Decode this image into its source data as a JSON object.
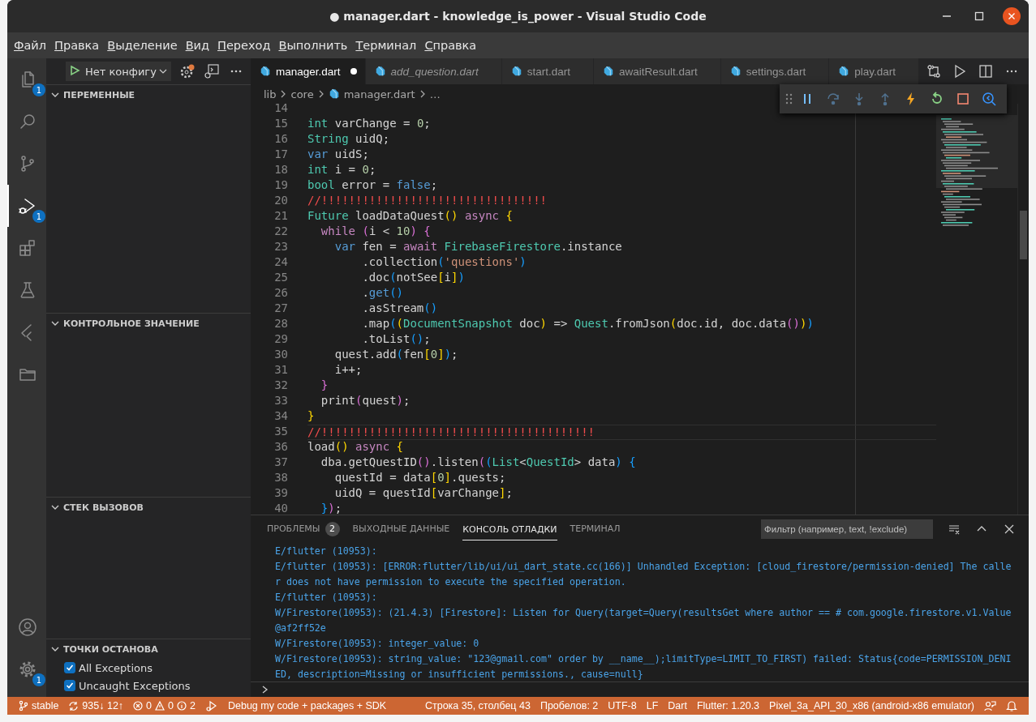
{
  "window": {
    "title": "● manager.dart - knowledge_is_power - Visual Studio Code"
  },
  "menu": [
    "Файл",
    "Правка",
    "Выделение",
    "Вид",
    "Переход",
    "Выполнить",
    "Терминал",
    "Справка"
  ],
  "activity_bar": {
    "items": [
      {
        "kind": "files",
        "selected": false,
        "badge": "1"
      },
      {
        "kind": "search",
        "selected": false
      },
      {
        "kind": "source",
        "selected": false
      },
      {
        "kind": "debug",
        "selected": true,
        "badge": "1"
      },
      {
        "kind": "extensions",
        "selected": false
      },
      {
        "kind": "flask",
        "selected": false
      },
      {
        "kind": "chevrons",
        "selected": false
      },
      {
        "kind": "folder",
        "selected": false
      }
    ],
    "bottom": [
      {
        "kind": "account",
        "selected": false
      },
      {
        "kind": "gear",
        "selected": false,
        "badge": "1"
      }
    ]
  },
  "sidebar": {
    "run_config": "Нет конфигу",
    "sections": [
      {
        "title": "ПЕРЕМЕННЫЕ",
        "expanded": true
      },
      {
        "title": "КОНТРОЛЬНОЕ ЗНАЧЕНИЕ",
        "expanded": true
      },
      {
        "title": "СТЕК ВЫЗОВОВ",
        "expanded": true
      },
      {
        "title": "ТОЧКИ ОСТАНОВА",
        "expanded": true
      }
    ],
    "breakpoints": [
      {
        "label": "All Exceptions",
        "checked": true
      },
      {
        "label": "Uncaught Exceptions",
        "checked": true
      }
    ]
  },
  "tabs": [
    {
      "label": "manager.dart",
      "selected": true,
      "preview": false,
      "modified": true
    },
    {
      "label": "add_question.dart",
      "selected": false,
      "preview": true,
      "modified": false
    },
    {
      "label": "start.dart",
      "selected": false,
      "preview": false,
      "modified": false
    },
    {
      "label": "awaitResult.dart",
      "selected": false,
      "preview": false,
      "modified": false
    },
    {
      "label": "settings.dart",
      "selected": false,
      "preview": false,
      "modified": false
    },
    {
      "label": "play.dart",
      "selected": false,
      "preview": false,
      "modified": false
    }
  ],
  "breadcrumbs": [
    "lib",
    "core",
    "manager.dart",
    "…"
  ],
  "debug_toolbar": [
    {
      "kind": "pause",
      "disabled": false
    },
    {
      "kind": "step-over",
      "disabled": true
    },
    {
      "kind": "step-into",
      "disabled": true
    },
    {
      "kind": "step-out",
      "disabled": true
    },
    {
      "kind": "hot-reload",
      "disabled": false
    },
    {
      "kind": "restart",
      "disabled": false
    },
    {
      "kind": "stop",
      "disabled": false
    },
    {
      "kind": "inspect",
      "disabled": false
    }
  ],
  "code": [
    {
      "number": "14",
      "current": false
    },
    {
      "number": "15",
      "current": false,
      "tokens": [
        {
          "text": "int",
          "kind": "type"
        },
        {
          "text": " varChange = ",
          "kind": "plain"
        },
        {
          "text": "0",
          "kind": "num"
        },
        {
          "text": ";",
          "kind": "plain"
        }
      ]
    },
    {
      "number": "16",
      "current": false,
      "tokens": [
        {
          "text": "String",
          "kind": "type"
        },
        {
          "text": " uidQ;",
          "kind": "plain"
        }
      ]
    },
    {
      "number": "17",
      "current": false,
      "tokens": [
        {
          "text": "var",
          "kind": "kw"
        },
        {
          "text": " uidS;",
          "kind": "plain"
        }
      ]
    },
    {
      "number": "18",
      "current": false,
      "tokens": [
        {
          "text": "int",
          "kind": "type"
        },
        {
          "text": " i = ",
          "kind": "plain"
        },
        {
          "text": "0",
          "kind": "num"
        },
        {
          "text": ";",
          "kind": "plain"
        }
      ]
    },
    {
      "number": "19",
      "current": false,
      "tokens": [
        {
          "text": "bool",
          "kind": "type"
        },
        {
          "text": " error = ",
          "kind": "plain"
        },
        {
          "text": "false",
          "kind": "kw"
        },
        {
          "text": ";",
          "kind": "plain"
        }
      ]
    },
    {
      "number": "20",
      "current": false,
      "tokens": [
        {
          "text": "//!!!!!!!!!!!!!!!!!!!!!!!!!!!!!!!!!",
          "kind": "comment"
        }
      ]
    },
    {
      "number": "21",
      "current": false,
      "tokens": [
        {
          "text": "Future",
          "kind": "type"
        },
        {
          "text": " loadDataQuest",
          "kind": "plain"
        },
        {
          "text": "()",
          "kind": "b1"
        },
        {
          "text": " async",
          "kind": "ctrl"
        },
        {
          "text": " {",
          "kind": "b1"
        }
      ]
    },
    {
      "number": "22",
      "current": false,
      "tokens": [
        {
          "text": "  while",
          "kind": "ctrl"
        },
        {
          "text": " (",
          "kind": "b2"
        },
        {
          "text": "i < ",
          "kind": "plain"
        },
        {
          "text": "10",
          "kind": "num"
        },
        {
          "text": ")",
          "kind": "b2"
        },
        {
          "text": " {",
          "kind": "b2"
        }
      ]
    },
    {
      "number": "23",
      "current": false,
      "tokens": [
        {
          "text": "    var",
          "kind": "kw"
        },
        {
          "text": " fen = ",
          "kind": "plain"
        },
        {
          "text": "await",
          "kind": "ctrl"
        },
        {
          "text": " FirebaseFirestore",
          "kind": "type"
        },
        {
          "text": ".instance",
          "kind": "plain"
        }
      ]
    },
    {
      "number": "24",
      "current": false,
      "tokens": [
        {
          "text": "        .collection",
          "kind": "plain"
        },
        {
          "text": "(",
          "kind": "b3"
        },
        {
          "text": "'questions'",
          "kind": "str"
        },
        {
          "text": ")",
          "kind": "b3"
        }
      ]
    },
    {
      "number": "25",
      "current": false,
      "tokens": [
        {
          "text": "        .doc",
          "kind": "plain"
        },
        {
          "text": "(",
          "kind": "b3"
        },
        {
          "text": "notSee",
          "kind": "plain"
        },
        {
          "text": "[",
          "kind": "b1"
        },
        {
          "text": "i",
          "kind": "plain"
        },
        {
          "text": "]",
          "kind": "b1"
        },
        {
          "text": ")",
          "kind": "b3"
        }
      ]
    },
    {
      "number": "26",
      "current": false,
      "tokens": [
        {
          "text": "        .",
          "kind": "plain"
        },
        {
          "text": "get",
          "kind": "kw"
        },
        {
          "text": "()",
          "kind": "b3"
        }
      ]
    },
    {
      "number": "27",
      "current": false,
      "tokens": [
        {
          "text": "        .asStream",
          "kind": "plain"
        },
        {
          "text": "()",
          "kind": "b3"
        }
      ]
    },
    {
      "number": "28",
      "current": false,
      "tokens": [
        {
          "text": "        .map",
          "kind": "plain"
        },
        {
          "text": "(",
          "kind": "b3"
        },
        {
          "text": "(",
          "kind": "b1"
        },
        {
          "text": "DocumentSnapshot",
          "kind": "type"
        },
        {
          "text": " doc",
          "kind": "plain"
        },
        {
          "text": ")",
          "kind": "b1"
        },
        {
          "text": " => ",
          "kind": "plain"
        },
        {
          "text": "Quest",
          "kind": "type"
        },
        {
          "text": ".fromJson",
          "kind": "plain"
        },
        {
          "text": "(",
          "kind": "b1"
        },
        {
          "text": "doc.id, doc.data",
          "kind": "plain"
        },
        {
          "text": "()",
          "kind": "b2"
        },
        {
          "text": ")",
          "kind": "b1"
        },
        {
          "text": ")",
          "kind": "b3"
        }
      ]
    },
    {
      "number": "29",
      "current": false,
      "tokens": [
        {
          "text": "        .toList",
          "kind": "plain"
        },
        {
          "text": "()",
          "kind": "b3"
        },
        {
          "text": ";",
          "kind": "plain"
        }
      ]
    },
    {
      "number": "30",
      "current": false,
      "tokens": [
        {
          "text": "    quest.add",
          "kind": "plain"
        },
        {
          "text": "(",
          "kind": "b3"
        },
        {
          "text": "fen",
          "kind": "plain"
        },
        {
          "text": "[",
          "kind": "b1"
        },
        {
          "text": "0",
          "kind": "num"
        },
        {
          "text": "]",
          "kind": "b1"
        },
        {
          "text": ")",
          "kind": "b3"
        },
        {
          "text": ";",
          "kind": "plain"
        }
      ]
    },
    {
      "number": "31",
      "current": false,
      "tokens": [
        {
          "text": "    i++;",
          "kind": "plain"
        }
      ]
    },
    {
      "number": "32",
      "current": false,
      "tokens": [
        {
          "text": "  }",
          "kind": "b2"
        }
      ]
    },
    {
      "number": "33",
      "current": false,
      "tokens": [
        {
          "text": "  print",
          "kind": "plain"
        },
        {
          "text": "(",
          "kind": "b2"
        },
        {
          "text": "quest",
          "kind": "plain"
        },
        {
          "text": ")",
          "kind": "b2"
        },
        {
          "text": ";",
          "kind": "plain"
        }
      ]
    },
    {
      "number": "34",
      "current": false,
      "tokens": [
        {
          "text": "}",
          "kind": "b1"
        }
      ]
    },
    {
      "number": "35",
      "current": true,
      "tokens": [
        {
          "text": "//!!!!!!!!!!!!!!!!!!!!!!!!!!!!!!!!!!!!!!!!",
          "kind": "comment"
        }
      ]
    },
    {
      "number": "36",
      "current": false,
      "tokens": [
        {
          "text": "load",
          "kind": "plain"
        },
        {
          "text": "()",
          "kind": "b1"
        },
        {
          "text": " async",
          "kind": "ctrl"
        },
        {
          "text": " {",
          "kind": "b1"
        }
      ]
    },
    {
      "number": "37",
      "current": false,
      "tokens": [
        {
          "text": "  dba.getQuestID",
          "kind": "plain"
        },
        {
          "text": "()",
          "kind": "b2"
        },
        {
          "text": ".listen",
          "kind": "plain"
        },
        {
          "text": "(",
          "kind": "b2"
        },
        {
          "text": "(",
          "kind": "b3"
        },
        {
          "text": "List",
          "kind": "type"
        },
        {
          "text": "<",
          "kind": "plain"
        },
        {
          "text": "QuestId",
          "kind": "type"
        },
        {
          "text": "> data",
          "kind": "plain"
        },
        {
          "text": ")",
          "kind": "b3"
        },
        {
          "text": " {",
          "kind": "b3"
        }
      ]
    },
    {
      "number": "38",
      "current": false,
      "tokens": [
        {
          "text": "    questId = data",
          "kind": "plain"
        },
        {
          "text": "[",
          "kind": "b1"
        },
        {
          "text": "0",
          "kind": "num"
        },
        {
          "text": "]",
          "kind": "b1"
        },
        {
          "text": ".quests;",
          "kind": "plain"
        }
      ]
    },
    {
      "number": "39",
      "current": false,
      "tokens": [
        {
          "text": "    uidQ = questId",
          "kind": "plain"
        },
        {
          "text": "[",
          "kind": "b1"
        },
        {
          "text": "varChange",
          "kind": "plain"
        },
        {
          "text": "]",
          "kind": "b1"
        },
        {
          "text": ";",
          "kind": "plain"
        }
      ]
    },
    {
      "number": "40",
      "current": false,
      "tokens": [
        {
          "text": "  }",
          "kind": "b3"
        },
        {
          "text": ")",
          "kind": "b2"
        },
        {
          "text": ";",
          "kind": "plain"
        }
      ]
    }
  ],
  "panel": {
    "tabs": [
      {
        "label": "ПРОБЛЕМЫ",
        "selected": false,
        "badge": "2"
      },
      {
        "label": "ВЫХОДНЫЕ ДАННЫЕ",
        "selected": false
      },
      {
        "label": "КОНСОЛЬ ОТЛАДКИ",
        "selected": true
      },
      {
        "label": "ТЕРМИНАЛ",
        "selected": false
      }
    ],
    "filter": {
      "placeholder": "Фильтр (например, text, !exclude)"
    },
    "output": [
      "E/flutter (10953):",
      "E/flutter (10953): [ERROR:flutter/lib/ui/ui_dart_state.cc(166)] Unhandled Exception: [cloud_firestore/permission-denied] The calle",
      "r does not have permission to execute the specified operation.",
      "E/flutter (10953):",
      "W/Firestore(10953): (21.4.3) [Firestore]: Listen for Query(target=Query(resultsGet where author == # com.google.firestore.v1.Value",
      "@af2ff52e",
      "W/Firestore(10953): integer_value: 0",
      "W/Firestore(10953): string_value: \"123@gmail.com\" order by __name__);limitType=LIMIT_TO_FIRST) failed: Status{code=PERMISSION_DENI",
      "ED, description=Missing or insufficient permissions., cause=null}"
    ]
  },
  "status_bar": {
    "left": [
      {
        "kind": "branch",
        "text": "stable"
      },
      {
        "kind": "sync",
        "text": "935↓ 12↑"
      },
      {
        "kind": "problems",
        "errors": "0",
        "warnings": "0",
        "infos": "2"
      },
      {
        "kind": "launch",
        "text": "Debug my code + packages + SDK"
      }
    ],
    "right": [
      {
        "kind": "text",
        "text": "Строка 35, столбец 43"
      },
      {
        "kind": "text",
        "text": "Пробелов: 2"
      },
      {
        "kind": "text",
        "text": "UTF-8"
      },
      {
        "kind": "text",
        "text": "LF"
      },
      {
        "kind": "text",
        "text": "Dart"
      },
      {
        "kind": "text",
        "text": "Flutter: 1.20.3"
      },
      {
        "kind": "text",
        "text": "Pixel_3a_API_30_x86 (android-x86 emulator)"
      },
      {
        "kind": "feedback"
      },
      {
        "kind": "bell"
      }
    ]
  }
}
